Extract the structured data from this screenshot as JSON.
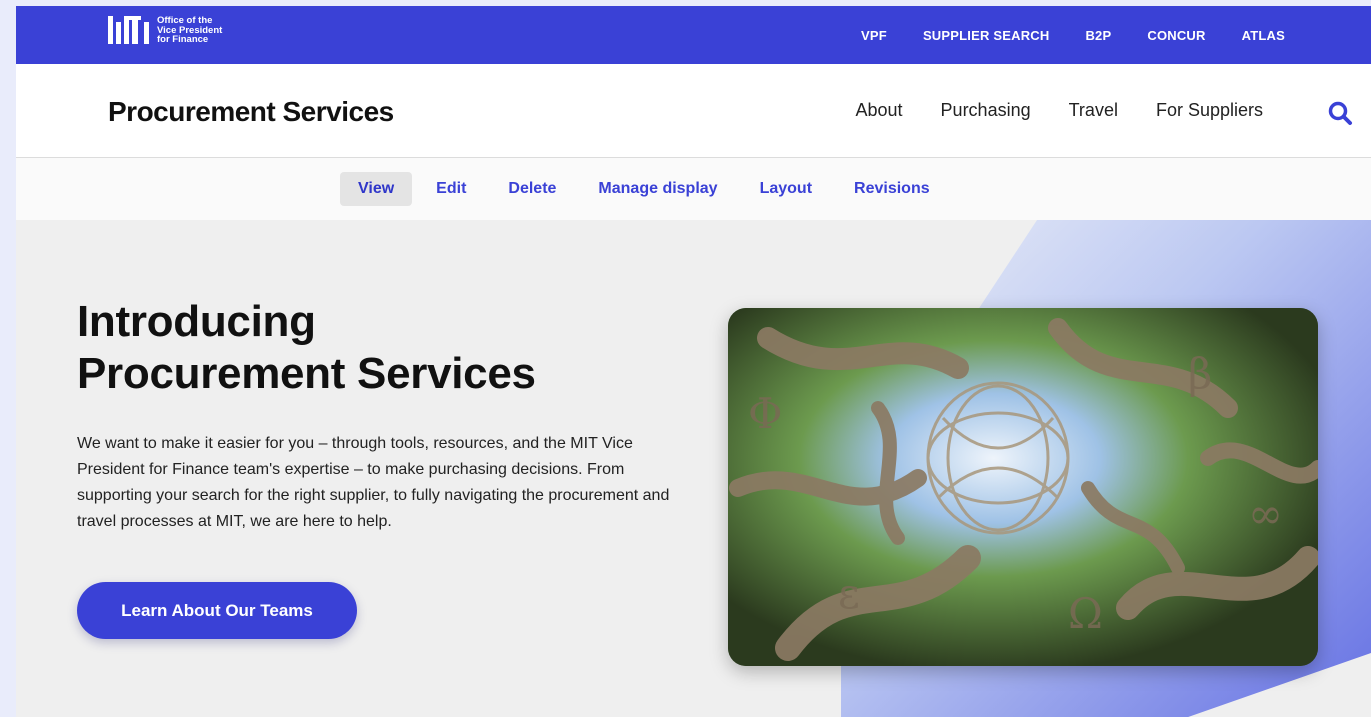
{
  "logo": {
    "line1": "Office of the",
    "line2": "Vice President",
    "line3": "for Finance"
  },
  "utility_nav": [
    "VPF",
    "SUPPLIER SEARCH",
    "B2P",
    "CONCUR",
    "ATLAS"
  ],
  "site_title": "Procurement Services",
  "main_nav": [
    "About",
    "Purchasing",
    "Travel",
    "For Suppliers"
  ],
  "search_icon": "search-icon",
  "admin_tabs": [
    "View",
    "Edit",
    "Delete",
    "Manage display",
    "Layout",
    "Revisions"
  ],
  "active_tab": "View",
  "hero": {
    "heading_line1": "Introducing",
    "heading_line2": "Procurement Services",
    "body": "We want to make it easier for you – through tools, resources, and the MIT Vice President for Finance team's expertise – to make purchasing decisions. From supporting your search for the right supplier, to fully navigating the procurement and travel processes at MIT, we are here to help.",
    "cta_label": "Learn About Our Teams"
  },
  "colors": {
    "brand": "#3a41d6",
    "text": "#111111",
    "background": "#efefef"
  }
}
